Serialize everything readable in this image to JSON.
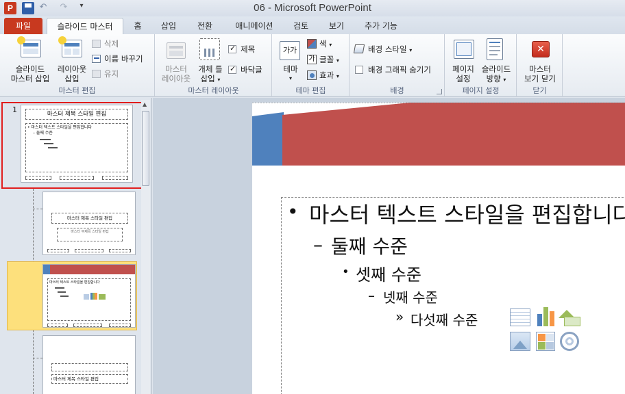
{
  "window": {
    "title": "06 - Microsoft PowerPoint"
  },
  "tabs": {
    "file": "파일",
    "slide_master": "슬라이드 마스터",
    "home": "홈",
    "insert": "삽입",
    "transitions": "전환",
    "animations": "애니메이션",
    "review": "검토",
    "view": "보기",
    "addins": "추가 기능"
  },
  "ribbon": {
    "edit_master": {
      "group": "마스터 편집",
      "insert_master_1": "슬라이드",
      "insert_master_2": "마스터 삽입",
      "insert_layout_1": "레이아웃",
      "insert_layout_2": "삽입",
      "delete": "삭제",
      "rename": "이름 바꾸기",
      "preserve": "유지"
    },
    "master_layout": {
      "group": "마스터 레이아웃",
      "master_layout_1": "마스터",
      "master_layout_2": "레이아웃",
      "insert_ph_1": "개체 틀",
      "insert_ph_2": "삽입",
      "title": "제목",
      "footers": "바닥글"
    },
    "edit_theme": {
      "group": "테마 편집",
      "themes_icon": "가가",
      "themes": "테마",
      "colors": "색",
      "fonts_icon": "가",
      "fonts": "글꼴",
      "effects": "효과"
    },
    "background": {
      "group": "배경",
      "styles": "배경 스타일",
      "hide": "배경 그래픽 숨기기"
    },
    "page_setup": {
      "group": "페이지 설정",
      "setup_1": "페이지",
      "setup_2": "설정",
      "orientation_1": "슬라이드",
      "orientation_2": "방향"
    },
    "close": {
      "group": "닫기",
      "close_1": "마스터",
      "close_2": "보기 닫기"
    }
  },
  "thumbnails": {
    "master_number": "1",
    "master_title": "마스터 제목 스타일 편집",
    "master_body": "• 마스터 텍스트 스타일을 편집합니다",
    "master_level2": "– 둘째 수준",
    "layout1_title": "마스터 제목 스타일 편집",
    "layout1_sub": "마스터 부제목 스타일 편집",
    "layout2_body": "마스터 텍스트 스타일을 편집합니다",
    "layout3_title": "마스터 제목 스타일 편집"
  },
  "slide": {
    "level1": "마스터 텍스트 스타일을 편집합니다",
    "level2": "둘째 수준",
    "level3": "셋째 수준",
    "level4": "넷째 수준",
    "level5": "다섯째 수준",
    "bullet1": "•",
    "bullet2": "–",
    "bullet3": "•",
    "bullet4": "–",
    "bullet5": "»"
  },
  "colors": {
    "accent_red": "#c0504d",
    "accent_blue": "#4f81bd",
    "file_tab": "#c8391f",
    "selected_layout": "#fde07c",
    "selection_border": "#e11d1d"
  }
}
